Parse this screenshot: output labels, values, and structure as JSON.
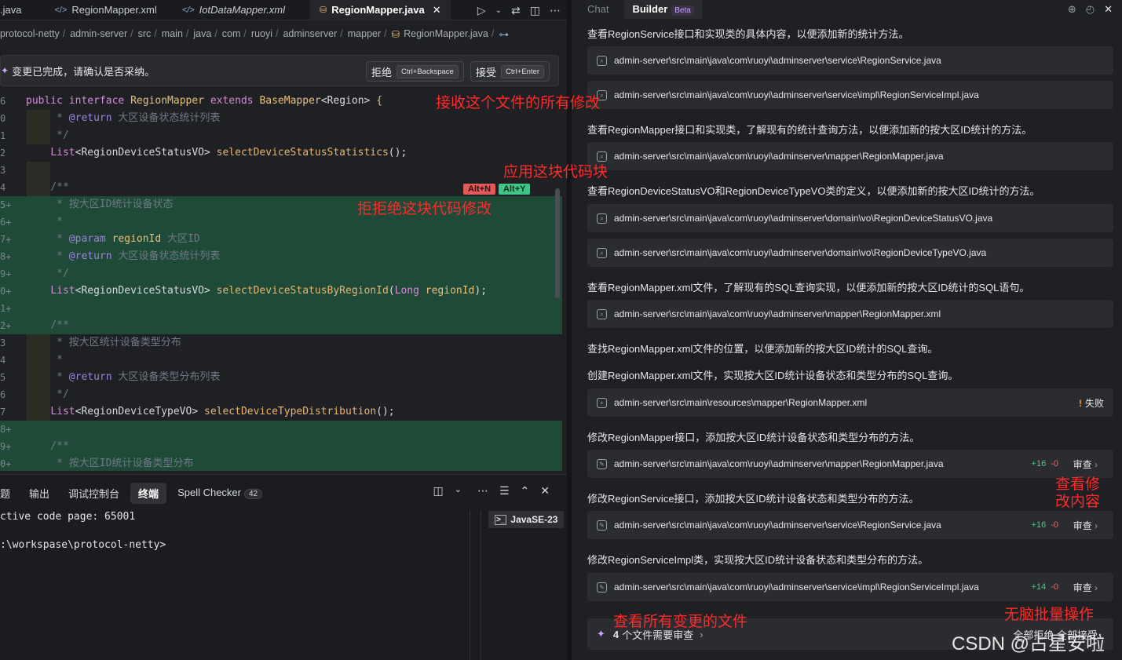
{
  "editor_tabs": [
    {
      "label": ".java",
      "icon": "java-file-icon"
    },
    {
      "label": "RegionMapper.xml",
      "icon": "xml-file-icon"
    },
    {
      "label": "IotDataMapper.xml",
      "icon": "xml-file-icon"
    },
    {
      "label": "RegionMapper.java",
      "icon": "java-interface-icon",
      "active": true
    }
  ],
  "tab_close_glyph": "✕",
  "breadcrumb": [
    "protocol-netty",
    "admin-server",
    "src",
    "main",
    "java",
    "com",
    "ruoyi",
    "adminserver",
    "mapper",
    "RegionMapper.java"
  ],
  "review_bar": {
    "message": "变更已完成，请确认是否采纳。",
    "reject_label": "拒绝",
    "reject_shortcut": "Ctrl+Backspace",
    "accept_label": "接受",
    "accept_shortcut": "Ctrl+Enter"
  },
  "code_lines": [
    {
      "n": "6",
      "text": "public interface RegionMapper extends BaseMapper<Region> {"
    },
    {
      "n": "0",
      "text": "     * @return 大区设备状态统计列表"
    },
    {
      "n": "1",
      "text": "     */"
    },
    {
      "n": "2",
      "text": "    List<RegionDeviceStatusVO> selectDeviceStatusStatistics();"
    },
    {
      "n": "3",
      "text": ""
    },
    {
      "n": "4",
      "text": "    /**"
    },
    {
      "n": "5+",
      "text": "     * 按大区ID统计设备状态"
    },
    {
      "n": "6+",
      "text": "     *"
    },
    {
      "n": "7+",
      "text": "     * @param regionId 大区ID"
    },
    {
      "n": "8+",
      "text": "     * @return 大区设备状态统计列表"
    },
    {
      "n": "9+",
      "text": "     */"
    },
    {
      "n": "0+",
      "text": "    List<RegionDeviceStatusVO> selectDeviceStatusByRegionId(Long regionId);"
    },
    {
      "n": "1+",
      "text": ""
    },
    {
      "n": "2+",
      "text": "    /**"
    },
    {
      "n": "3",
      "text": "     * 按大区统计设备类型分布"
    },
    {
      "n": "4",
      "text": "     *"
    },
    {
      "n": "5",
      "text": "     * @return 大区设备类型分布列表"
    },
    {
      "n": "6",
      "text": "     */"
    },
    {
      "n": "7",
      "text": "    List<RegionDeviceTypeVO> selectDeviceTypeDistribution();"
    },
    {
      "n": "8+",
      "text": ""
    },
    {
      "n": "9+",
      "text": "    /**"
    },
    {
      "n": "0+",
      "text": "     * 按大区ID统计设备类型分布"
    }
  ],
  "hunk_badges": {
    "reject": "Alt+N",
    "accept": "Alt+Y"
  },
  "bottom_panel": {
    "tabs": [
      "题",
      "输出",
      "调试控制台",
      "终端",
      "Spell Checker"
    ],
    "active_tab": "终端",
    "spell_count": "42",
    "terminal_lines": [
      "ctive code page: 65001",
      ":\\workspase\\protocol-netty>"
    ],
    "terminal_instance": "JavaSE-23"
  },
  "chat_panel": {
    "tabs": [
      "Chat",
      "Builder"
    ],
    "active_tab": "Builder",
    "beta_label": "Beta",
    "items": [
      {
        "type": "step",
        "text": "查看RegionService接口和实现类的具体内容，以便添加新的统计方法。"
      },
      {
        "type": "file",
        "icon": "search",
        "path": "admin-server\\src\\main\\java\\com\\ruoyi\\adminserver\\service\\RegionService.java"
      },
      {
        "type": "file",
        "icon": "search",
        "path": "admin-server\\src\\main\\java\\com\\ruoyi\\adminserver\\service\\impl\\RegionServiceImpl.java"
      },
      {
        "type": "step",
        "text": "查看RegionMapper接口和实现类，了解现有的统计查询方法，以便添加新的按大区ID统计的方法。"
      },
      {
        "type": "file",
        "icon": "search",
        "path": "admin-server\\src\\main\\java\\com\\ruoyi\\adminserver\\mapper\\RegionMapper.java"
      },
      {
        "type": "step",
        "text": "查看RegionDeviceStatusVO和RegionDeviceTypeVO类的定义，以便添加新的按大区ID统计的方法。"
      },
      {
        "type": "file",
        "icon": "search",
        "path": "admin-server\\src\\main\\java\\com\\ruoyi\\adminserver\\domain\\vo\\RegionDeviceStatusVO.java"
      },
      {
        "type": "file",
        "icon": "search",
        "path": "admin-server\\src\\main\\java\\com\\ruoyi\\adminserver\\domain\\vo\\RegionDeviceTypeVO.java"
      },
      {
        "type": "step",
        "text": "查看RegionMapper.xml文件，了解现有的SQL查询实现，以便添加新的按大区ID统计的SQL语句。"
      },
      {
        "type": "file",
        "icon": "search",
        "path": "admin-server\\src\\main\\java\\com\\ruoyi\\adminserver\\mapper\\RegionMapper.xml"
      },
      {
        "type": "step",
        "text": "查找RegionMapper.xml文件的位置，以便添加新的按大区ID统计的SQL查询。"
      },
      {
        "type": "step",
        "text": "创建RegionMapper.xml文件，实现按大区ID统计设备状态和类型分布的SQL查询。"
      },
      {
        "type": "file",
        "icon": "add",
        "path": "admin-server\\src\\main\\resources\\mapper\\RegionMapper.xml",
        "status": "失败"
      },
      {
        "type": "step",
        "text": "修改RegionMapper接口，添加按大区ID统计设备状态和类型分布的方法。"
      },
      {
        "type": "file",
        "icon": "edit",
        "path": "admin-server\\src\\main\\java\\com\\ruoyi\\adminserver\\mapper\\RegionMapper.java",
        "added": "+16",
        "removed": "-0",
        "action": "审查"
      },
      {
        "type": "step",
        "text": "修改RegionService接口，添加按大区ID统计设备状态和类型分布的方法。"
      },
      {
        "type": "file",
        "icon": "edit",
        "path": "admin-server\\src\\main\\java\\com\\ruoyi\\adminserver\\service\\RegionService.java",
        "added": "+16",
        "removed": "-0",
        "action": "审查"
      },
      {
        "type": "step",
        "text": "修改RegionServiceImpl类，实现按大区ID统计设备状态和类型分布的方法。"
      },
      {
        "type": "file",
        "icon": "edit",
        "path": "admin-server\\src\\main\\java\\com\\ruoyi\\adminserver\\service\\impl\\RegionServiceImpl.java",
        "added": "+14",
        "removed": "-0",
        "action": "审查"
      }
    ],
    "summary": {
      "count": "4",
      "text": "个文件需要审查",
      "actions": "全部拒绝   全部接受"
    }
  },
  "annotations": [
    {
      "id": "accept-all",
      "text": "接收这个文件的所有修改"
    },
    {
      "id": "apply-block",
      "text": "应用这块代码块"
    },
    {
      "id": "reject-block",
      "text": "拒拒绝这块代码修改"
    },
    {
      "id": "view-change",
      "text": "查看修\n改内容"
    },
    {
      "id": "view-all-files",
      "text": "查看所有变更的文件"
    },
    {
      "id": "batch-op",
      "text": "无脑批量操作"
    }
  ],
  "watermark": "CSDN @占星安啦",
  "colors": {
    "accent": "#c9a9ff",
    "added_bg": "#1f4a38",
    "annotation": "#ff2a2a",
    "plus": "#4fc48a",
    "minus": "#e36a6a"
  }
}
